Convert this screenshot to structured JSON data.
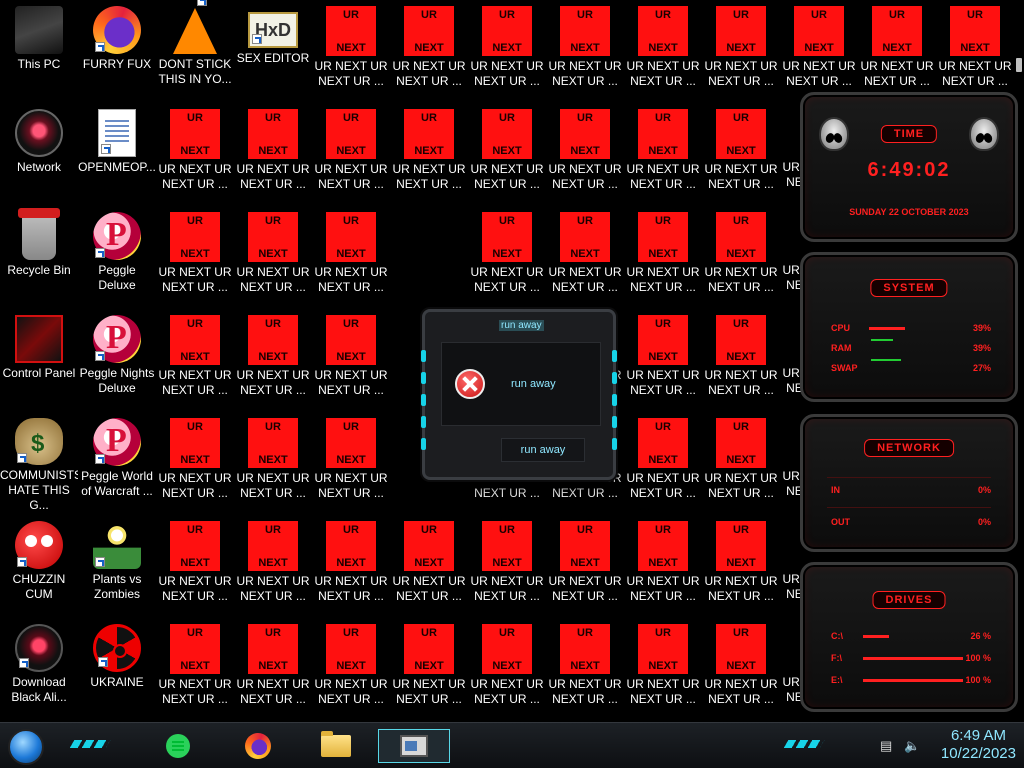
{
  "desktop": {
    "icons": [
      {
        "label": "This PC",
        "icon": "computer-icon",
        "cls": "g-pc",
        "shortcut": false
      },
      {
        "label": "FURRY FUX",
        "icon": "firefox-icon",
        "cls": "g-ff",
        "shortcut": true
      },
      {
        "label": "DONT STICK\nTHIS IN YO...",
        "icon": "vlc-cone-icon",
        "cls": "g-vlc",
        "shortcut": true
      },
      {
        "label": "SEX EDITOR",
        "icon": "hxd-editor-icon",
        "cls": "g-hxd",
        "shortcut": true,
        "text": "HxD"
      },
      {
        "label": "Network",
        "icon": "network-icon",
        "cls": "g-net",
        "shortcut": false
      },
      {
        "label": "OPENMEOP...",
        "icon": "document-icon",
        "cls": "g-doc",
        "shortcut": true
      },
      {
        "label": "Recycle Bin",
        "icon": "recycle-bin-icon",
        "cls": "g-bin",
        "shortcut": false
      },
      {
        "label": "Peggle Deluxe",
        "icon": "peggle-icon",
        "cls": "g-peg",
        "shortcut": true
      },
      {
        "label": "Control Panel",
        "icon": "control-panel-icon",
        "cls": "g-cp",
        "shortcut": false
      },
      {
        "label": "Peggle Nights\nDeluxe",
        "icon": "peggle-nights-icon",
        "cls": "g-peg",
        "shortcut": true
      },
      {
        "label": "COMMUNISTS\nHATE THIS G...",
        "icon": "money-bag-icon",
        "cls": "g-bag",
        "shortcut": true
      },
      {
        "label": "Peggle World\nof Warcraft ...",
        "icon": "peggle-wow-icon",
        "cls": "g-peg",
        "shortcut": true
      },
      {
        "label": "CHUZZIN\nCUM",
        "icon": "chuzzle-icon",
        "cls": "g-chz",
        "shortcut": true
      },
      {
        "label": "Plants vs\nZombies",
        "icon": "plants-vs-zombies-icon",
        "cls": "g-pvz",
        "shortcut": true
      },
      {
        "label": "Download\nBlack Ali...",
        "icon": "alienware-icon",
        "cls": "g-dba",
        "shortcut": true
      },
      {
        "label": "UKRAINE",
        "icon": "radiation-icon",
        "cls": "g-ukr",
        "shortcut": true
      }
    ],
    "ur_icon": {
      "top": "UR",
      "bottom": "NEXT",
      "label": "UR NEXT UR\nNEXT UR ..."
    }
  },
  "dialog": {
    "title": "run away",
    "message": "run away",
    "button": "run away"
  },
  "gadget": {
    "time_title": "TIME",
    "time": "6:49:02",
    "date": "SUNDAY 22 OCTOBER 2023",
    "system_title": "SYSTEM",
    "system_rows": [
      {
        "label": "CPU",
        "value": "39%"
      },
      {
        "label": "RAM",
        "value": "39%"
      },
      {
        "label": "SWAP",
        "value": "27%"
      }
    ],
    "network_title": "NETWORK",
    "network_rows": [
      {
        "label": "IN",
        "value": "0%"
      },
      {
        "label": "OUT",
        "value": "0%"
      }
    ],
    "drives_title": "DRIVES",
    "drive_rows": [
      {
        "label": "C:\\",
        "value": "26 %"
      },
      {
        "label": "F:\\",
        "value": "100 %"
      },
      {
        "label": "E:\\",
        "value": "100 %"
      }
    ]
  },
  "taskbar": {
    "apps": [
      {
        "name": "notes-app-icon"
      },
      {
        "name": "firefox-icon"
      },
      {
        "name": "file-explorer-icon"
      },
      {
        "name": "active-window-icon"
      }
    ],
    "time": "6:49 AM",
    "date": "10/22/2023"
  },
  "colors": {
    "accent_red": "#ff2020",
    "accent_cyan": "#8fe7ff",
    "icon_red": "#ff1010"
  }
}
